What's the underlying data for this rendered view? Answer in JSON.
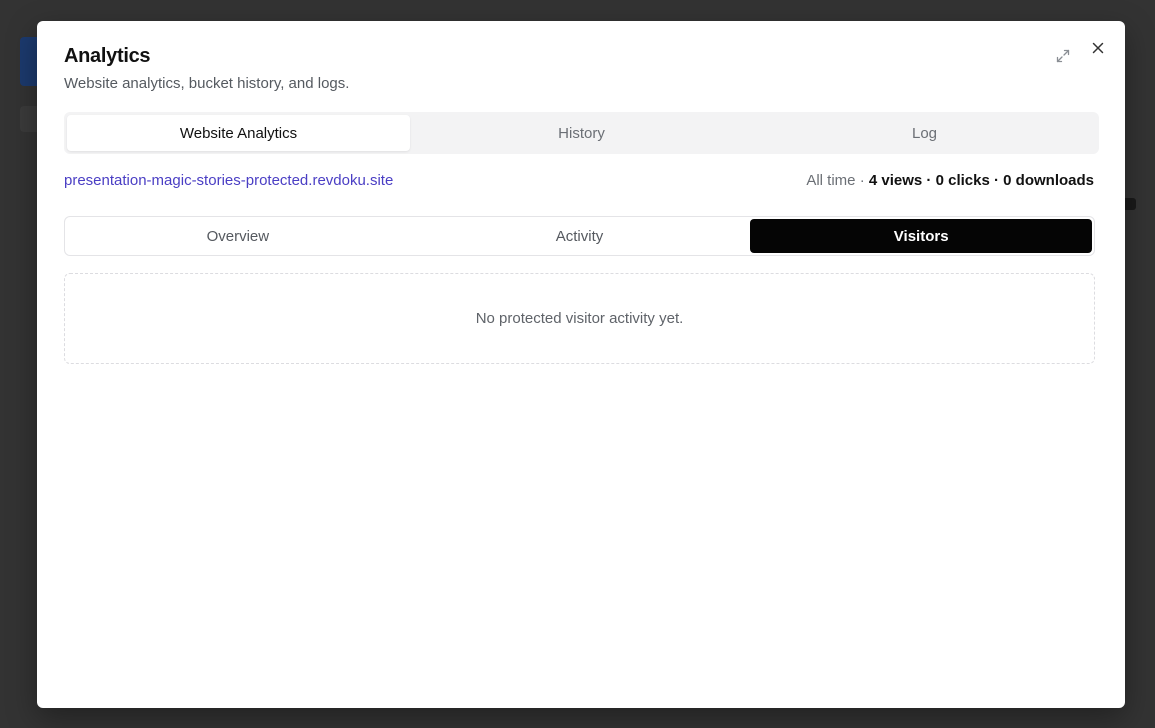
{
  "modal": {
    "title": "Analytics",
    "subtitle": "Website analytics, bucket history, and logs."
  },
  "icons": {
    "expand": "expand-icon",
    "close": "close-icon"
  },
  "top_tabs": [
    {
      "label": "Website Analytics",
      "active": true
    },
    {
      "label": "History",
      "active": false
    },
    {
      "label": "Log",
      "active": false
    }
  ],
  "site": {
    "link": "presentation-magic-stories-protected.revdoku.site"
  },
  "stats": {
    "period": "All time",
    "sep": "·",
    "views": "4 views",
    "clicks": "0 clicks",
    "downloads": "0 downloads"
  },
  "sub_tabs": [
    {
      "label": "Overview",
      "active": false
    },
    {
      "label": "Activity",
      "active": false
    },
    {
      "label": "Visitors",
      "active": true
    }
  ],
  "empty_state": {
    "message": "No protected visitor activity yet."
  },
  "colors": {
    "backdrop": "#333333",
    "link": "#4a3ec4",
    "active_subtab": "#050505"
  }
}
